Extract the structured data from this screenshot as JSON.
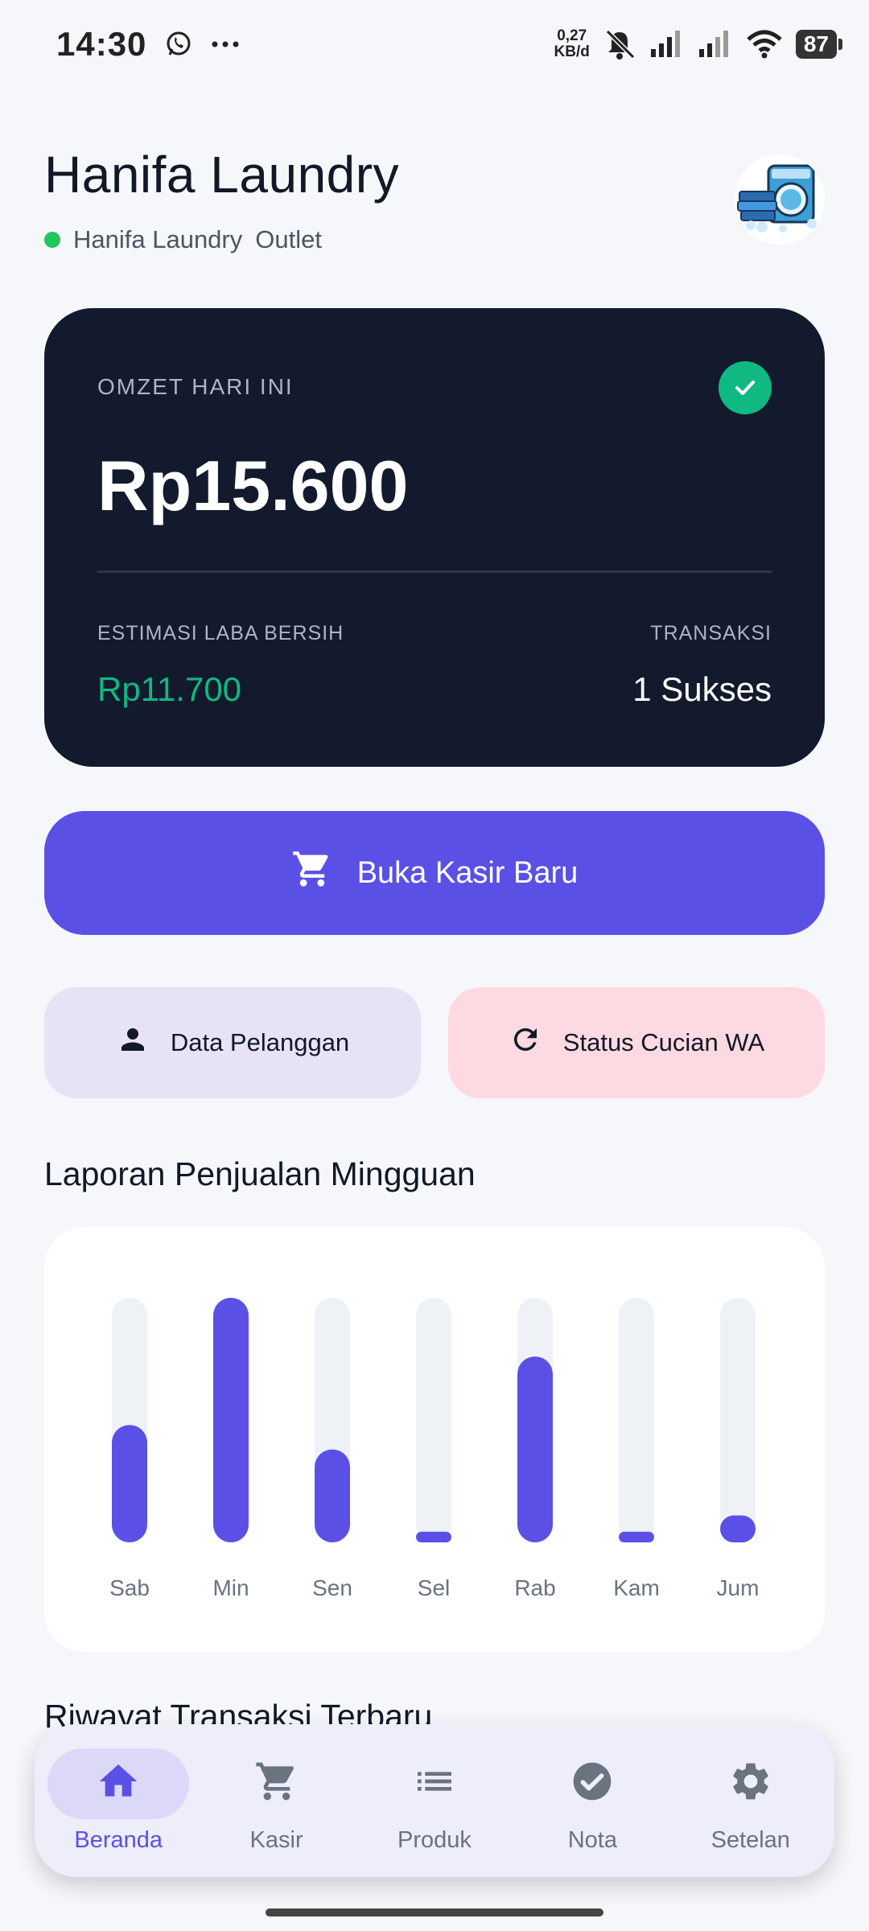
{
  "status_bar": {
    "time": "14:30",
    "net_speed_value": "0,27",
    "net_speed_unit": "KB/d",
    "battery": "87"
  },
  "header": {
    "title": "Hanifa Laundry",
    "outlet_name": "Hanifa Laundry",
    "outlet_suffix": "Outlet",
    "status_color": "#22c55e"
  },
  "revenue_card": {
    "label": "OMZET HARI INI",
    "amount": "Rp15.600",
    "profit_label": "ESTIMASI LABA BERSIH",
    "profit_value": "Rp11.700",
    "transactions_label": "TRANSAKSI",
    "transactions_value": "1 Sukses"
  },
  "actions": {
    "main_label": "Buka Kasir Baru",
    "customers_label": "Data Pelanggan",
    "wa_status_label": "Status Cucian WA"
  },
  "weekly": {
    "title": "Laporan Penjualan Mingguan"
  },
  "chart_data": {
    "type": "bar",
    "categories": [
      "Sab",
      "Min",
      "Sen",
      "Sel",
      "Rab",
      "Kam",
      "Jum"
    ],
    "values": [
      0.48,
      1.0,
      0.38,
      0.04,
      0.76,
      0.04,
      0.11
    ],
    "ylim": [
      0,
      1
    ],
    "grid": false,
    "title": "",
    "xlabel": "",
    "ylabel": ""
  },
  "next_section": {
    "title": "Riwayat Transaksi Terbaru"
  },
  "nav": {
    "items": [
      {
        "label": "Beranda",
        "icon": "home-icon"
      },
      {
        "label": "Kasir",
        "icon": "cart-icon"
      },
      {
        "label": "Produk",
        "icon": "list-icon"
      },
      {
        "label": "Nota",
        "icon": "check-circle-icon"
      },
      {
        "label": "Setelan",
        "icon": "gear-icon"
      }
    ]
  },
  "colors": {
    "primary": "#5b50e5",
    "card_dark": "#131a2e",
    "success": "#10b981",
    "track": "#eef1f6"
  }
}
